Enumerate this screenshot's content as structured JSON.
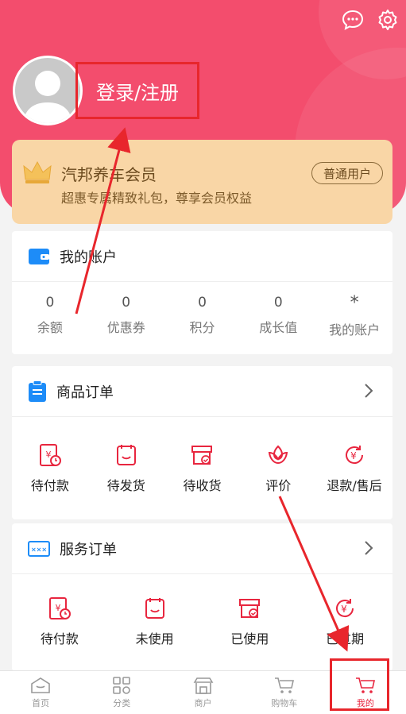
{
  "header": {
    "login_label": "登录/注册"
  },
  "vip": {
    "title": "汽邦养车会员",
    "subtitle": "超惠专属精致礼包，尊享会员权益",
    "badge": "普通用户"
  },
  "account": {
    "title": "我的账户",
    "stats": [
      {
        "value": "0",
        "label": "余额"
      },
      {
        "value": "0",
        "label": "优惠券"
      },
      {
        "value": "0",
        "label": "积分"
      },
      {
        "value": "0",
        "label": "成长值"
      },
      {
        "value": "*",
        "label": "我的账户"
      }
    ]
  },
  "goods_orders": {
    "title": "商品订单",
    "items": [
      {
        "label": "待付款",
        "icon": "pending-payment-icon"
      },
      {
        "label": "待发货",
        "icon": "pending-shipment-icon"
      },
      {
        "label": "待收货",
        "icon": "pending-receipt-icon"
      },
      {
        "label": "评价",
        "icon": "review-icon"
      },
      {
        "label": "退款/售后",
        "icon": "refund-icon"
      }
    ]
  },
  "service_orders": {
    "title": "服务订单",
    "items": [
      {
        "label": "待付款",
        "icon": "pending-payment-icon"
      },
      {
        "label": "未使用",
        "icon": "unused-icon"
      },
      {
        "label": "已使用",
        "icon": "used-icon"
      },
      {
        "label": "已过期",
        "icon": "expired-icon"
      }
    ]
  },
  "tabbar": {
    "tabs": [
      {
        "label": "首页",
        "icon": "home-icon"
      },
      {
        "label": "分类",
        "icon": "category-icon"
      },
      {
        "label": "商户",
        "icon": "store-icon"
      },
      {
        "label": "购物车",
        "icon": "cart-icon"
      },
      {
        "label": "我的",
        "icon": "cart-icon",
        "active": true
      }
    ]
  },
  "colors": {
    "header": "#f34d6d",
    "vip_card": "#f9d6a6",
    "accent": "#e8263f",
    "highlight_box": "#e8262c"
  }
}
